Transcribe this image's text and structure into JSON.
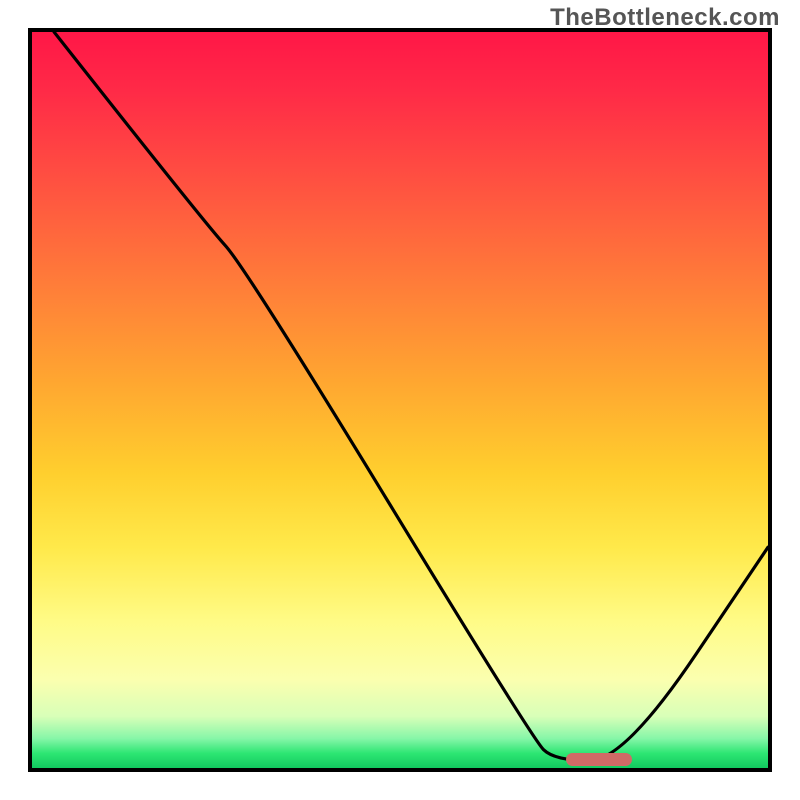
{
  "watermark": "TheBottleneck.com",
  "chart_data": {
    "type": "line",
    "title": "",
    "xlabel": "",
    "ylabel": "",
    "xlim": [
      0,
      100
    ],
    "ylim": [
      0,
      100
    ],
    "grid": false,
    "legend": false,
    "gradient_stops": [
      {
        "pos": 0,
        "color": "#ff1747"
      },
      {
        "pos": 8,
        "color": "#ff2a47"
      },
      {
        "pos": 22,
        "color": "#ff5640"
      },
      {
        "pos": 36,
        "color": "#ff8238"
      },
      {
        "pos": 48,
        "color": "#ffa830"
      },
      {
        "pos": 60,
        "color": "#ffcf2e"
      },
      {
        "pos": 70,
        "color": "#ffe94a"
      },
      {
        "pos": 80,
        "color": "#fffb86"
      },
      {
        "pos": 88,
        "color": "#fbffaf"
      },
      {
        "pos": 93,
        "color": "#d8ffb8"
      },
      {
        "pos": 96,
        "color": "#86f6a8"
      },
      {
        "pos": 98,
        "color": "#2de673"
      },
      {
        "pos": 100,
        "color": "#12c95f"
      }
    ],
    "series": [
      {
        "name": "bottleneck-curve",
        "color": "#000000",
        "points": [
          {
            "x": 3.0,
            "y": 100.0
          },
          {
            "x": 23.5,
            "y": 74.0
          },
          {
            "x": 29.0,
            "y": 68.0
          },
          {
            "x": 68.0,
            "y": 4.0
          },
          {
            "x": 71.0,
            "y": 1.0
          },
          {
            "x": 80.5,
            "y": 1.0
          },
          {
            "x": 100.0,
            "y": 30.0
          }
        ]
      }
    ],
    "marker": {
      "name": "optimal-range",
      "x_start": 72.5,
      "x_end": 81.5,
      "y": 1.2,
      "color": "#d06a66"
    }
  }
}
